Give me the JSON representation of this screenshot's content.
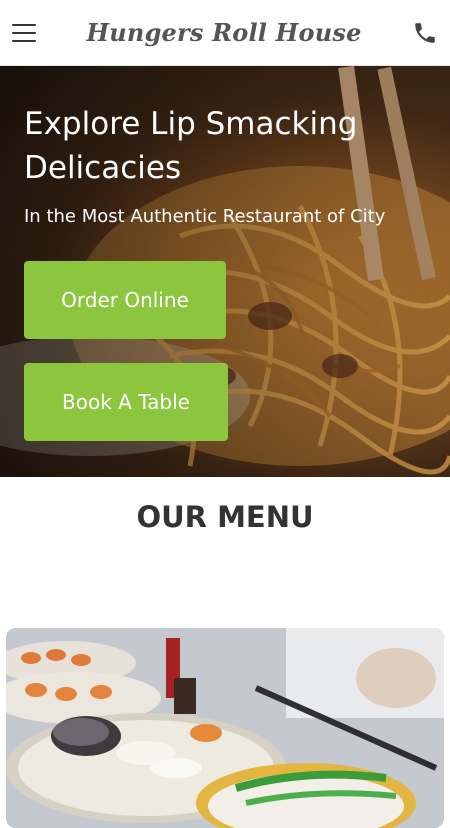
{
  "header": {
    "brand": "Hungers Roll House",
    "menu_icon": "hamburger-menu-icon",
    "phone_icon": "phone-icon"
  },
  "hero": {
    "title": "Explore Lip Smacking Delicacies",
    "subtitle": "In the Most Authentic Restaurant of City",
    "order_label": "Order Online",
    "book_label": "Book A Table"
  },
  "menu_section": {
    "title": "OUR MENU"
  },
  "colors": {
    "accent": "#8cc63e",
    "heading": "#333333",
    "brand_text": "#555555"
  }
}
